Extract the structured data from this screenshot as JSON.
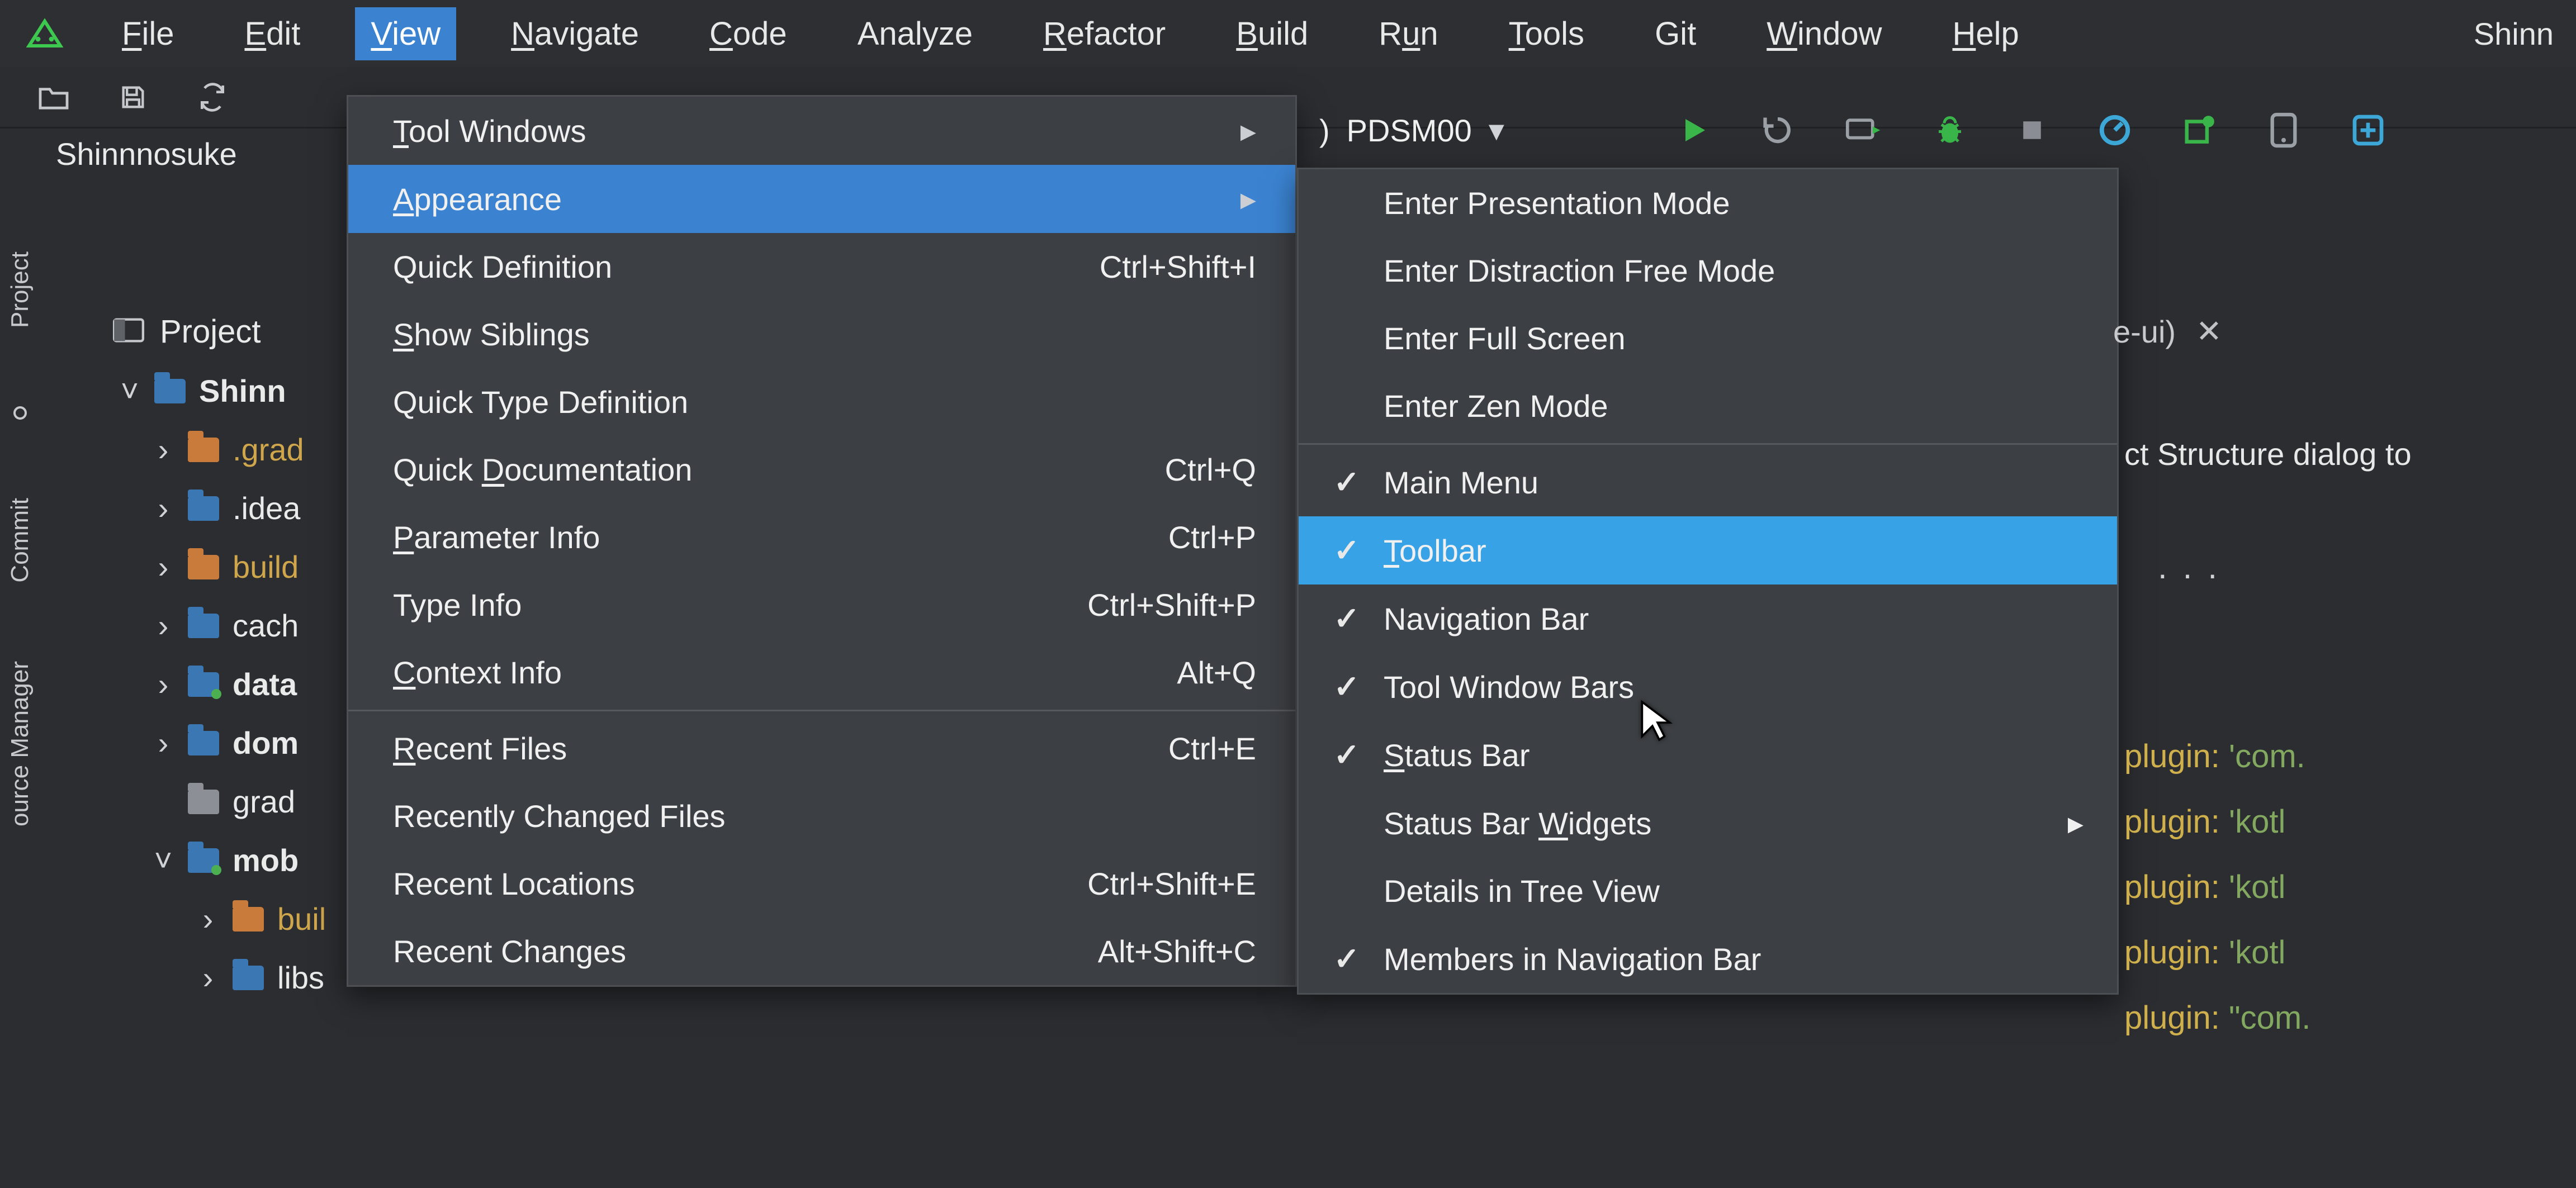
{
  "menubar": {
    "items": [
      {
        "label": "File",
        "mn": "F"
      },
      {
        "label": "Edit",
        "mn": "E"
      },
      {
        "label": "View",
        "mn": "V",
        "active": true
      },
      {
        "label": "Navigate",
        "mn": "N"
      },
      {
        "label": "Code",
        "mn": "C"
      },
      {
        "label": "Analyze",
        "mn": ""
      },
      {
        "label": "Refactor",
        "mn": "R"
      },
      {
        "label": "Build",
        "mn": "B"
      },
      {
        "label": "Run",
        "mn": "u"
      },
      {
        "label": "Tools",
        "mn": "T"
      },
      {
        "label": "Git",
        "mn": ""
      },
      {
        "label": "Window",
        "mn": "W"
      },
      {
        "label": "Help",
        "mn": "H"
      }
    ],
    "window_title": "Shinn"
  },
  "run_config": {
    "label": "PDSM00",
    "prefix": ")"
  },
  "navbar": {
    "project": "Shinnnosuke"
  },
  "gutter": {
    "items": [
      {
        "label": "Project"
      },
      {
        "label": "Commit"
      },
      {
        "label": "ource Manager"
      }
    ]
  },
  "project_panel": {
    "header": "Project",
    "tree": [
      {
        "chev": "˅",
        "folder": "blue",
        "name": "Shinn",
        "bold": true,
        "dot": false,
        "gold": false
      },
      {
        "chev": "›",
        "folder": "orange",
        "name": ".grad",
        "bold": false,
        "dot": false,
        "gold": true
      },
      {
        "chev": "›",
        "folder": "blue",
        "name": ".idea",
        "bold": false,
        "dot": false,
        "gold": false
      },
      {
        "chev": "›",
        "folder": "orange",
        "name": "build",
        "bold": false,
        "dot": false,
        "gold": true
      },
      {
        "chev": "›",
        "folder": "blue",
        "name": "cach",
        "bold": false,
        "dot": false,
        "gold": false
      },
      {
        "chev": "›",
        "folder": "blue",
        "name": "data",
        "bold": true,
        "dot": true,
        "gold": false
      },
      {
        "chev": "›",
        "folder": "blue",
        "name": "dom",
        "bold": true,
        "dot": false,
        "gold": false
      },
      {
        "chev": "",
        "folder": "gray",
        "name": "grad",
        "bold": false,
        "dot": false,
        "gold": false
      },
      {
        "chev": "˅",
        "folder": "blue",
        "name": "mob",
        "bold": true,
        "dot": true,
        "gold": false
      },
      {
        "chev": "›",
        "folder": "orange",
        "name": "buil",
        "bold": false,
        "dot": false,
        "gold": true
      },
      {
        "chev": "›",
        "folder": "blue",
        "name": "libs",
        "bold": false,
        "dot": false,
        "gold": false
      }
    ]
  },
  "view_menu": {
    "items": [
      {
        "label": "Tool Windows",
        "mn": "T",
        "shortcut": "",
        "arrow": true
      },
      {
        "label": "Appearance",
        "mn": "A",
        "shortcut": "",
        "arrow": true,
        "highlight": true
      },
      {
        "label": "Quick Definition",
        "mn": "",
        "shortcut": "Ctrl+Shift+I"
      },
      {
        "label": "Show Siblings",
        "mn": "S",
        "shortcut": ""
      },
      {
        "label": "Quick Type Definition",
        "mn": "",
        "shortcut": ""
      },
      {
        "label": "Quick Documentation",
        "mn": "D",
        "shortcut": "Ctrl+Q"
      },
      {
        "label": "Parameter Info",
        "mn": "P",
        "shortcut": "Ctrl+P"
      },
      {
        "label": "Type Info",
        "mn": "",
        "shortcut": "Ctrl+Shift+P"
      },
      {
        "label": "Context Info",
        "mn": "C",
        "shortcut": "Alt+Q",
        "sep_after": true
      },
      {
        "label": "Recent Files",
        "mn": "R",
        "shortcut": "Ctrl+E"
      },
      {
        "label": "Recently Changed Files",
        "mn": "",
        "shortcut": ""
      },
      {
        "label": "Recent Locations",
        "mn": "",
        "shortcut": "Ctrl+Shift+E"
      },
      {
        "label": "Recent Changes",
        "mn": "",
        "shortcut": "Alt+Shift+C"
      }
    ]
  },
  "appearance_submenu": {
    "items": [
      {
        "label": "Enter Presentation Mode",
        "check": false
      },
      {
        "label": "Enter Distraction Free Mode",
        "check": false
      },
      {
        "label": "Enter Full Screen",
        "check": false
      },
      {
        "label": "Enter Zen Mode",
        "check": false,
        "sep_after": true
      },
      {
        "label": "Main Menu",
        "check": true
      },
      {
        "label": "Toolbar",
        "mn": "T",
        "check": true,
        "highlight": true
      },
      {
        "label": "Navigation Bar",
        "check": true
      },
      {
        "label": "Tool Window Bars",
        "check": true
      },
      {
        "label": "Status Bar",
        "mn": "S",
        "check": true
      },
      {
        "label": "Status Bar Widgets",
        "mn": "W",
        "arrow": true
      },
      {
        "label": "Details in Tree View",
        "check": false
      },
      {
        "label": "Members in Navigation Bar",
        "check": true
      }
    ]
  },
  "editor": {
    "tab_label": "e-ui)",
    "banner": "ct Structure dialog to",
    "code_lines": [
      {
        "kw": "plugin:",
        "str": " 'com."
      },
      {
        "kw": "plugin:",
        "str": " 'kotl"
      },
      {
        "kw": "plugin:",
        "str": " 'kotl"
      },
      {
        "kw": "plugin:",
        "str": " 'kotl"
      },
      {
        "kw": "plugin:",
        "str": " \"com."
      }
    ]
  },
  "toolbar_icons": {
    "open": "folder-open-icon",
    "save": "save-icon",
    "sync": "sync-icon",
    "run": "run-triangle-icon",
    "debug": "debug-bug-icon",
    "refresh": "refresh-icon",
    "profiler": "profiler-icon",
    "avd": "avd-icon",
    "sdk": "sdk-icon",
    "more": "more-icon"
  }
}
